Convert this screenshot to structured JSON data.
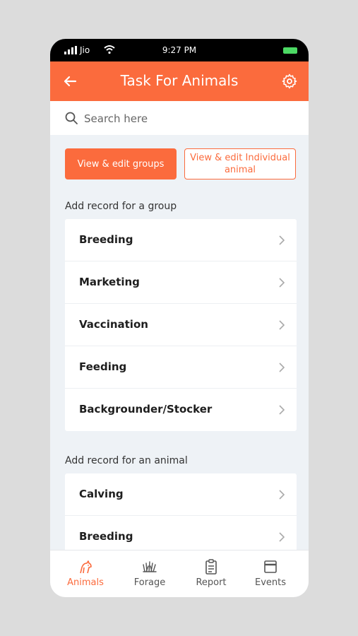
{
  "status_bar": {
    "carrier": "Jio",
    "time": "9:27 PM"
  },
  "app_bar": {
    "title": "Task For Animals"
  },
  "search": {
    "placeholder": "Search here"
  },
  "actions": {
    "view_groups": "View & edit groups",
    "view_individual": "View & edit Individual animal"
  },
  "group_section": {
    "label": "Add record for a group",
    "items": [
      "Breeding",
      "Marketing",
      "Vaccination",
      "Feeding",
      "Backgrounder/Stocker"
    ]
  },
  "animal_section": {
    "label": "Add record for an animal",
    "items": [
      "Calving",
      "Breeding"
    ]
  },
  "bottom_nav": {
    "tabs": [
      "Animals",
      "Forage",
      "Report",
      "Events"
    ],
    "active": "Animals"
  },
  "colors": {
    "accent": "#fb6b3d",
    "background": "#eef2f6"
  }
}
